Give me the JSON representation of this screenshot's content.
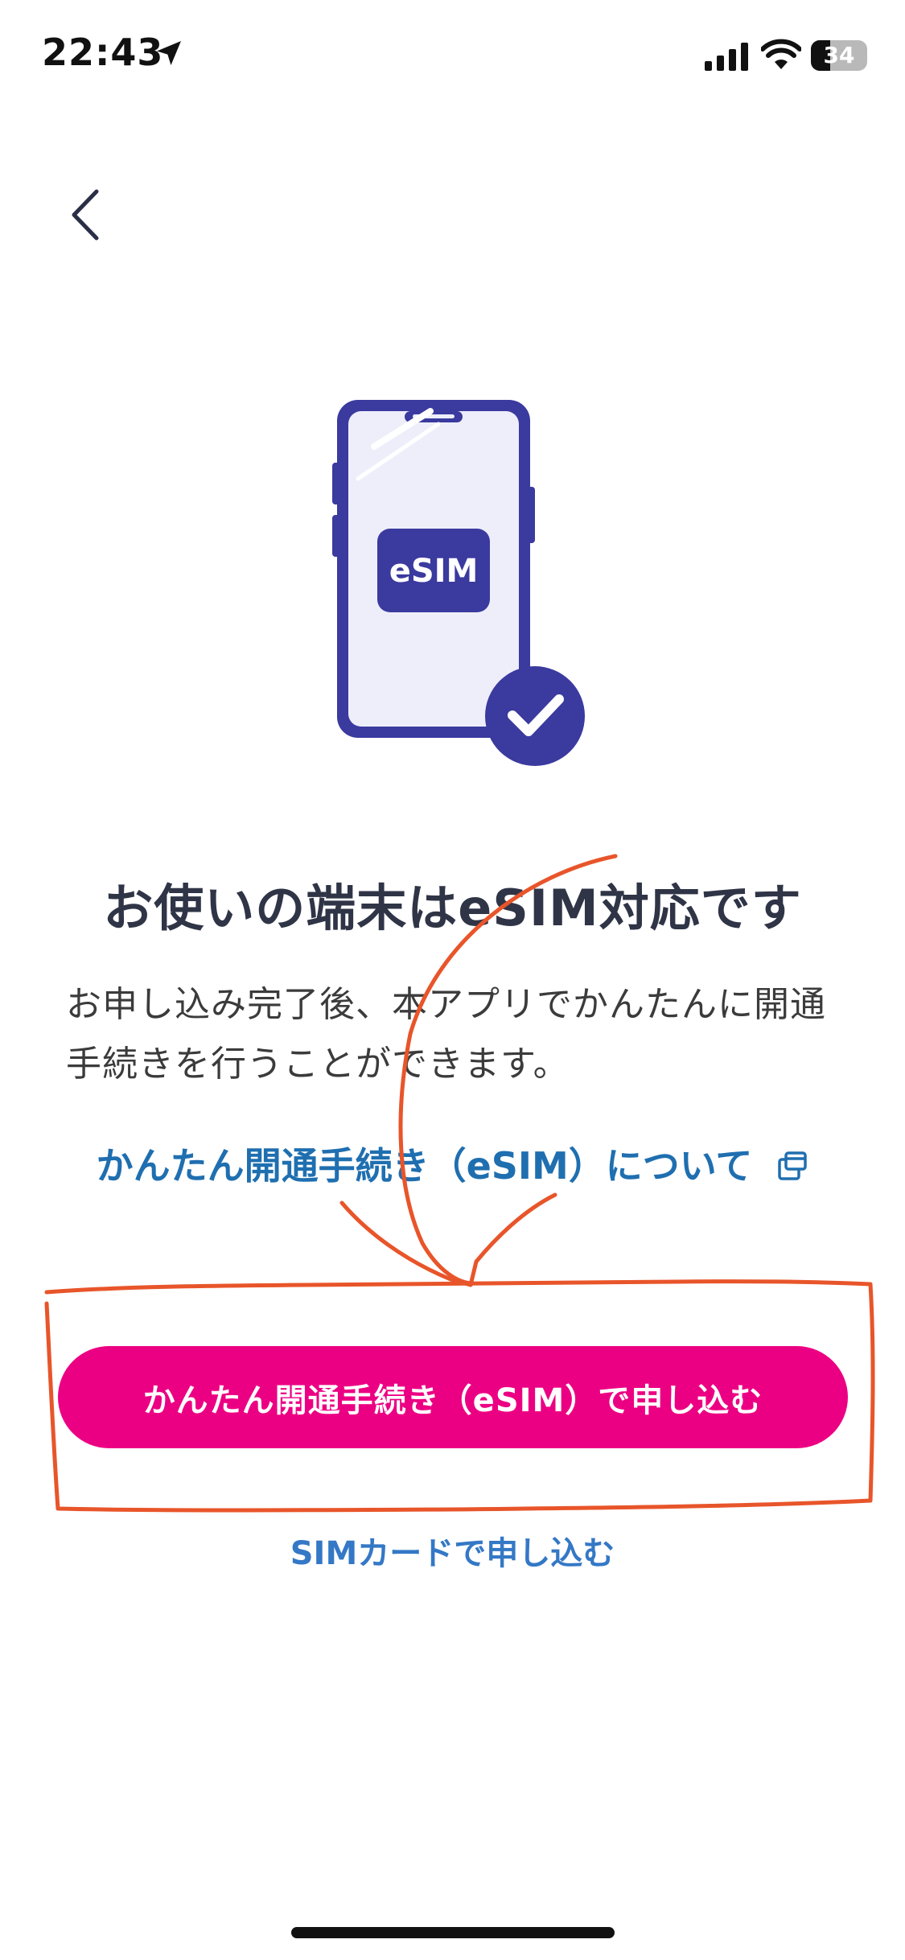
{
  "status_bar": {
    "time": "22:43",
    "battery": "34",
    "battery_level": 0.34
  },
  "illustration": {
    "badge_text": "eSIM",
    "phone_color": "#3a3a9f",
    "screen_color": "#eeeefb"
  },
  "main": {
    "title": "お使いの端末はeSIM対応です",
    "description": "お申し込み完了後、本アプリでかんたんに開通手続きを行うことができます。",
    "info_link": "かんたん開通手続き（eSIM）について"
  },
  "actions": {
    "primary_button": "かんたん開通手続き（eSIM）で申し込む",
    "secondary_link": "SIMカードで申し込む"
  },
  "colors": {
    "primary": "#ec0083",
    "link": "#1f6fb0",
    "annotation": "#e8552a"
  }
}
